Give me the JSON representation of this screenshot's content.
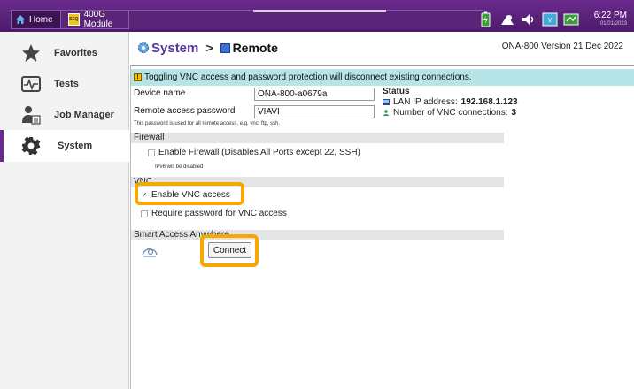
{
  "topbar": {
    "home_label": "Home",
    "module_icon_text": "SEQ",
    "module_label": "400G Module",
    "time": "6:22 PM",
    "date": "01/01/2023",
    "accent": "#5a2478"
  },
  "sidebar": {
    "items": [
      {
        "label": "Favorites",
        "icon": "star-icon"
      },
      {
        "label": "Tests",
        "icon": "tests-icon"
      },
      {
        "label": "Job Manager",
        "icon": "job-manager-icon"
      },
      {
        "label": "System",
        "icon": "gear-icon",
        "active": true
      }
    ]
  },
  "header": {
    "section": "System",
    "separator": ">",
    "page": "Remote",
    "version": "ONA-800 Version 21 Dec 2022"
  },
  "banner": {
    "warn_glyph": "!",
    "text": "Toggling VNC access and password protection will disconnect existing connections.",
    "color": "#b7e4e6"
  },
  "form": {
    "device_name_label": "Device name",
    "device_name_value": "ONA-800-a0679a",
    "password_label": "Remote access password",
    "password_value": "VIAVI",
    "password_hint": "This password is used for all remote access, e.g. vnc, ftp, ssh."
  },
  "status": {
    "title": "Status",
    "lan_label": "LAN IP address:",
    "lan_value": "192.168.1.123",
    "vnc_label": "Number of VNC connections:",
    "vnc_value": "3"
  },
  "firewall": {
    "section": "Firewall",
    "enable_label": "Enable Firewall (Disables All Ports except 22, SSH)",
    "enable_checked": false,
    "note": "IPv6 will be disabled"
  },
  "vnc": {
    "section": "VNC",
    "enable_label": "Enable VNC access",
    "enable_checked": true,
    "enable_mark": "✓",
    "password_label": "Require password for VNC access",
    "password_checked": false
  },
  "smart_access": {
    "section": "Smart Access Anywhere",
    "connect_label": "Connect"
  },
  "highlight_color": "#f7a700"
}
